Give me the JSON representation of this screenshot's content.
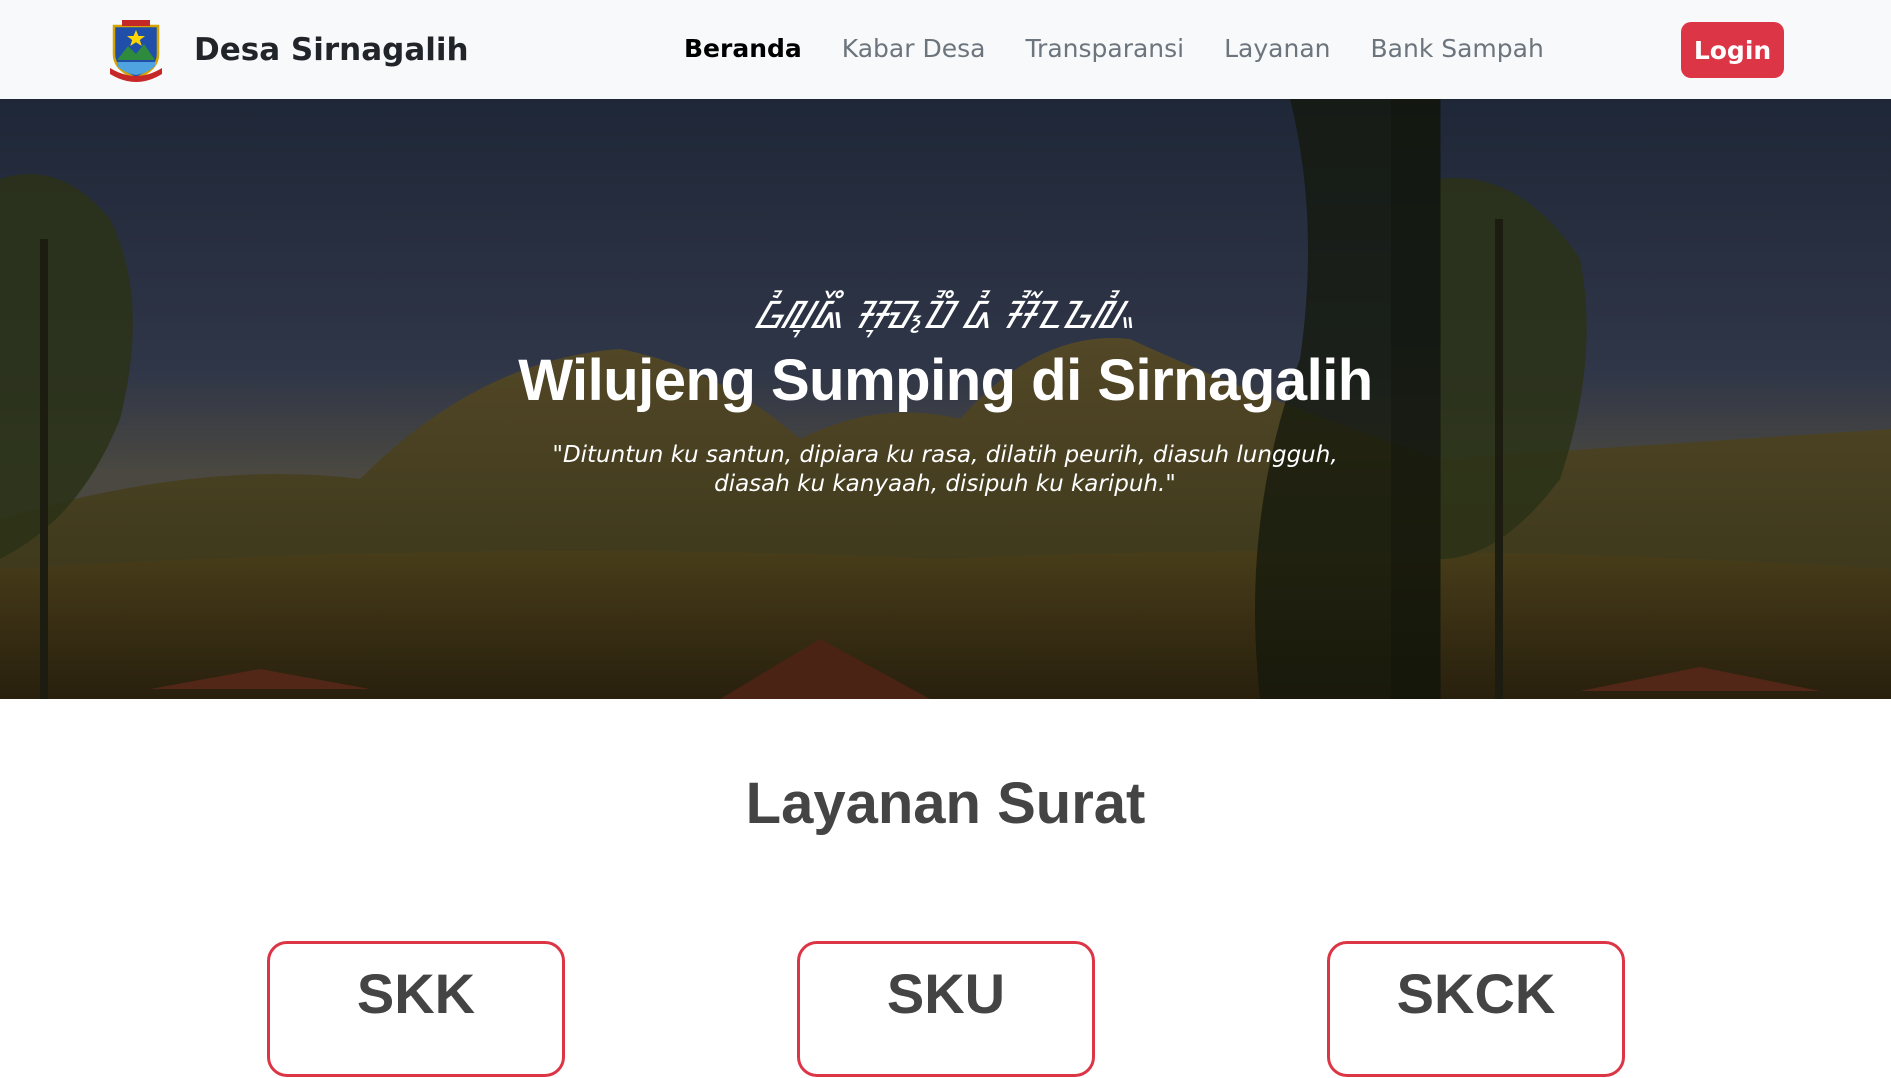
{
  "brand": {
    "name": "Desa Sirnagalih",
    "logo_icon": "village-emblem-icon"
  },
  "nav": {
    "items": [
      {
        "label": "Beranda",
        "active": true
      },
      {
        "label": "Kabar Desa",
        "active": false
      },
      {
        "label": "Transparansi",
        "active": false
      },
      {
        "label": "Layanan",
        "active": false
      },
      {
        "label": "Bank Sampah",
        "active": false
      }
    ],
    "login_label": "Login"
  },
  "hero": {
    "script_text": "ᮝᮤᮜᮥᮏᮨᮀ ᮞᮥ�span ᮓᮤ ᮞᮤᮁᮔᮌᮜᮤᮂ",
    "title": "Wilujeng Sumping di Sirnagalih",
    "quote_line1": "\"Dituntun ku santun, dipiara ku rasa, dilatih peurih, diasuh lungguh,",
    "quote_line2": "diasah ku kanyaah, disipuh ku karipuh.\""
  },
  "services": {
    "title": "Layanan Surat",
    "items": [
      {
        "label": "SKK"
      },
      {
        "label": "SKU"
      },
      {
        "label": "SKCK"
      }
    ]
  },
  "colors": {
    "accent": "#dc3545",
    "navbar_bg": "#f8f9fa",
    "heading": "#444444"
  }
}
